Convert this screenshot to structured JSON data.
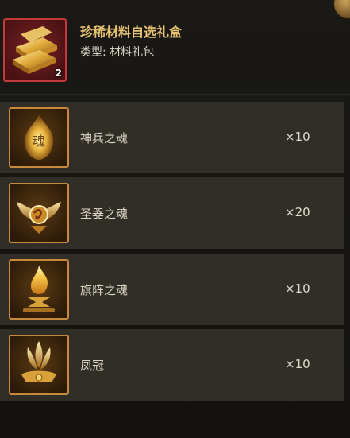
{
  "header": {
    "title": "珍稀材料自选礼盒",
    "type_label": "类型: 材料礼包",
    "count": "2",
    "icon": "golden-gift-box-icon"
  },
  "items": [
    {
      "name": "神兵之魂",
      "quantity": "×10",
      "icon": "golden-soul-flame-icon"
    },
    {
      "name": "圣器之魂",
      "quantity": "×20",
      "icon": "winged-emblem-icon"
    },
    {
      "name": "旗阵之魂",
      "quantity": "×10",
      "icon": "flame-brazier-icon"
    },
    {
      "name": "凤冠",
      "quantity": "×10",
      "icon": "phoenix-crown-icon"
    }
  ],
  "colors": {
    "title": "#e6c271",
    "header_border": "#c23a3a",
    "item_border": "#c88a3a",
    "row_bg": "#36332b"
  }
}
